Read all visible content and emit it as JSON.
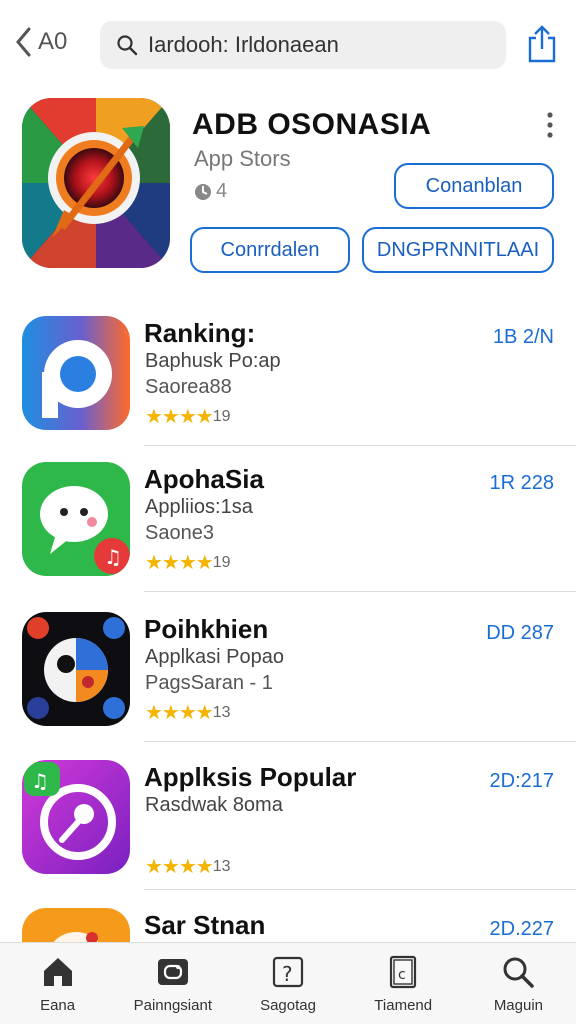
{
  "header": {
    "back_label": "A0",
    "search_value": "Iardooh: Irldonaean",
    "search_placeholder": "Search"
  },
  "featured": {
    "title": "ADB OSONASIA",
    "subtitle": "App Stors",
    "rating": "4",
    "buttons": [
      "Conanblan",
      "Conrrdalen",
      "DNGPRNNITLAAI"
    ]
  },
  "apps": [
    {
      "name": "Ranking:",
      "line2": "Baphusk Po:ap",
      "line3": "Saorea88",
      "rating": "19",
      "size": "1B 2/N",
      "icon": "parking-p-icon"
    },
    {
      "name": "ApohaSia",
      "line2": "Appliios:1sa",
      "line3": "Saone3",
      "rating": "19",
      "size": "1R 228",
      "icon": "chat-music-icon"
    },
    {
      "name": "Poihkhien",
      "line2": "Applkasi Popao",
      "line3": "PagsSaran - 1",
      "rating": "13",
      "size": "DD 287",
      "icon": "bird-games-icon"
    },
    {
      "name": "Applksis Popular",
      "line2": "Rasdwak 8oma",
      "line3": "",
      "rating": "13",
      "size": "2D:217",
      "icon": "purple-gauge-icon"
    },
    {
      "name": "Sar Stnan",
      "line2": "",
      "line3": "",
      "rating": "",
      "size": "2D.227",
      "icon": "orange-app-icon"
    }
  ],
  "tabs": [
    {
      "label": "Eana",
      "icon": "home-icon"
    },
    {
      "label": "Painngsiant",
      "icon": "games-icon"
    },
    {
      "label": "Sagotag",
      "icon": "help-icon"
    },
    {
      "label": "Tiamend",
      "icon": "document-icon"
    },
    {
      "label": "Maguin",
      "icon": "search-icon"
    }
  ],
  "colors": {
    "accent": "#1a6dd4",
    "star": "#f4b400"
  }
}
